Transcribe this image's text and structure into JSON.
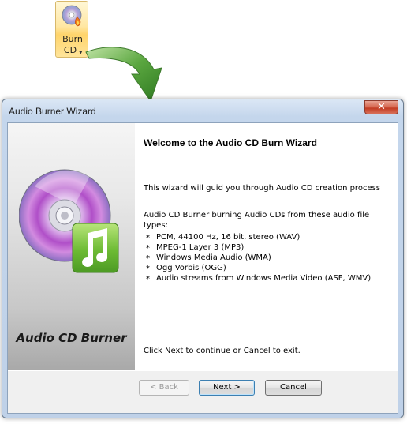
{
  "ribbon": {
    "label_line1": "Burn",
    "label_line2": "CD",
    "icon": "burn-cd-icon"
  },
  "window": {
    "title": "Audio Burner Wizard",
    "close_label": "✕"
  },
  "side_panel": {
    "brand": "Audio CD Burner",
    "icon": "audio-cd-music-note-icon"
  },
  "content": {
    "heading": "Welcome to the Audio CD Burn Wizard",
    "intro": "This wizard will guid you through Audio CD creation process",
    "formats_intro_1": "Audio CD Burner burning Audio CDs from these audio file",
    "formats_intro_2": "types:",
    "formats": [
      "PCM, 44100 Hz, 16 bit, stereo (WAV)",
      "MPEG-1 Layer 3 (MP3)",
      "Windows Media Audio (WMA)",
      "Ogg Vorbis (OGG)",
      "Audio streams from Windows Media Video (ASF, WMV)"
    ],
    "footer": "Click Next to continue or Cancel to exit."
  },
  "buttons": {
    "back": "< Back",
    "next": "Next >",
    "cancel": "Cancel"
  },
  "colors": {
    "arrow": "#4f9a3b",
    "close_button": "#c8452c",
    "music_tile": "#7cc242"
  }
}
